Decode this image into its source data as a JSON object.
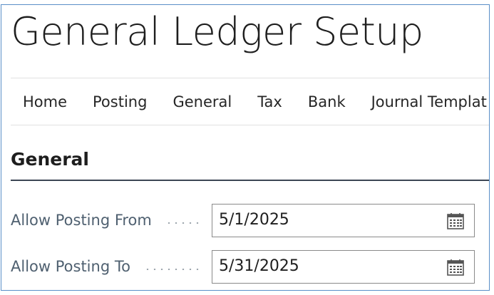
{
  "page": {
    "title": "General Ledger Setup"
  },
  "tabs": [
    {
      "label": "Home"
    },
    {
      "label": "Posting"
    },
    {
      "label": "General"
    },
    {
      "label": "Tax"
    },
    {
      "label": "Bank"
    },
    {
      "label": "Journal Templat"
    }
  ],
  "section": {
    "title": "General",
    "fields": [
      {
        "label": "Allow Posting From",
        "value": "5/1/2025",
        "icon": "calendar-icon"
      },
      {
        "label": "Allow Posting To",
        "value": "5/31/2025",
        "icon": "calendar-icon"
      }
    ]
  },
  "colors": {
    "frame_border": "#5a8fc8",
    "label_text": "#4f6070",
    "section_rule": "#3c4654"
  }
}
